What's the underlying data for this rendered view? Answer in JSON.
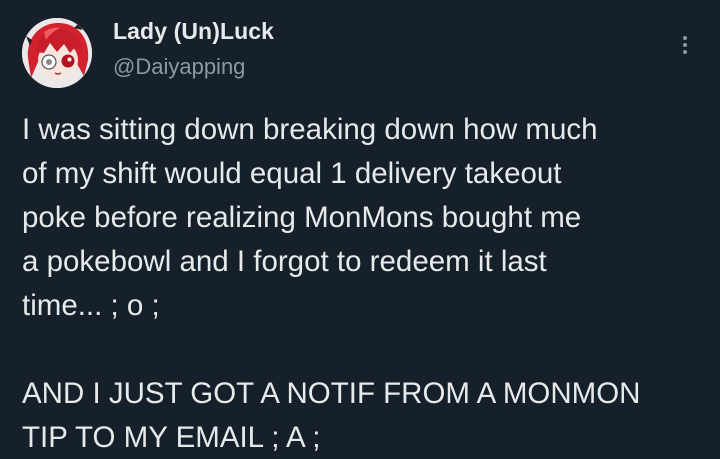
{
  "author": {
    "display_name": "Lady (Un)Luck",
    "handle": "@Daiyapping",
    "avatar_icon": "anime-character-avatar"
  },
  "menu": {
    "icon": "more-vertical-icon"
  },
  "tweet": {
    "paragraph_1": "I was sitting down breaking down how much\nof my shift would equal 1 delivery takeout\npoke before realizing MonMons bought me\na pokebowl and I forgot to redeem it last\ntime... ; o ;",
    "paragraph_2": "AND I JUST GOT A NOTIF FROM A MONMON\nTIP TO MY EMAIL ; A ;"
  },
  "colors": {
    "background": "#15202b",
    "text": "#e7e9ea",
    "secondary_text": "#8b98a5"
  }
}
